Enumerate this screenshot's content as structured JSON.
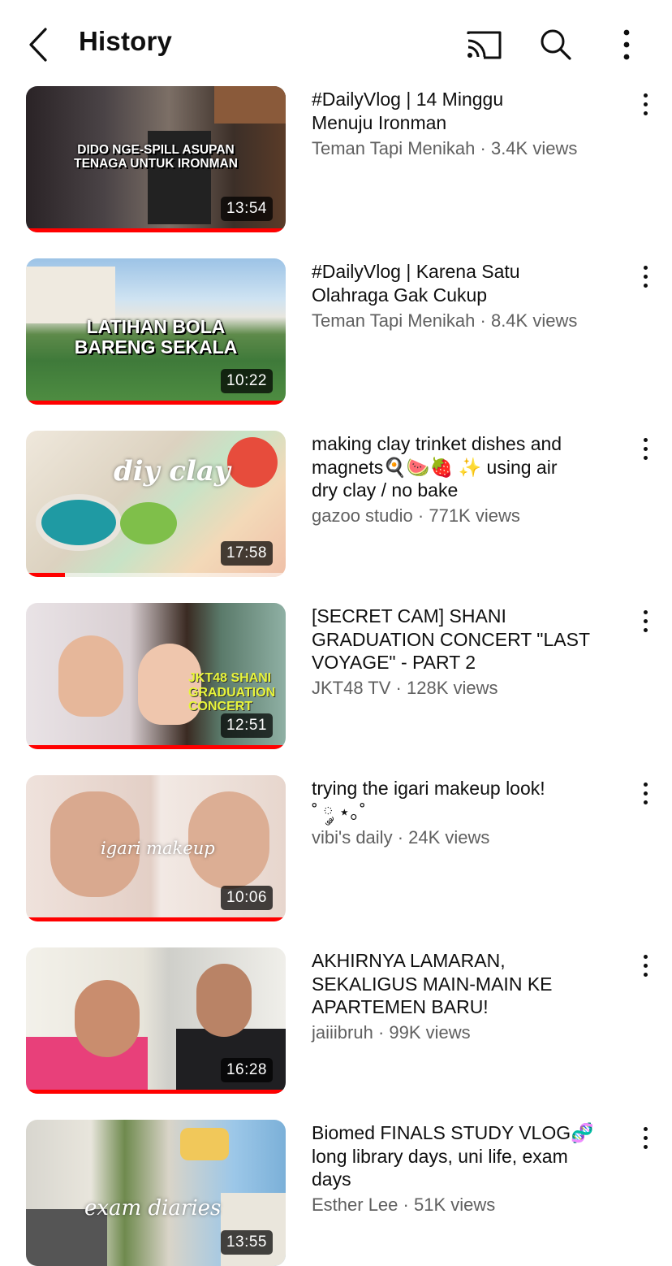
{
  "header": {
    "title": "History",
    "back_icon": "chevron-left-icon",
    "cast_icon": "cast-icon",
    "search_icon": "search-icon",
    "more_icon": "more-vertical-icon"
  },
  "colors": {
    "text_primary": "#0f0f0f",
    "text_secondary": "#606060",
    "progress": "#ff0000"
  },
  "videos": [
    {
      "title": "#DailyVlog | 14 Minggu\nMenuju Ironman",
      "channel": "Teman Tapi Menikah",
      "separator": "·",
      "views": "3.4K views",
      "duration": "13:54",
      "thumb_text": "DIDO NGE-SPILL ASUPAN\nTENAGA UNTUK IRONMAN",
      "progress": 1.0
    },
    {
      "title": "#DailyVlog | Karena Satu\nOlahraga Gak Cukup",
      "channel": "Teman Tapi Menikah",
      "separator": "·",
      "views": "8.4K views",
      "duration": "10:22",
      "thumb_text": "LATIHAN BOLA\nBARENG SEKALA",
      "progress": 1.0
    },
    {
      "title": "making clay trinket dishes and\nmagnets🍳🍉🍓 ✨ using air\ndry clay / no bake",
      "channel": "gazoo studio",
      "separator": "·",
      "views": "771K views",
      "duration": "17:58",
      "thumb_text": "diy clay",
      "progress": 0.15
    },
    {
      "title": "[SECRET CAM] SHANI\nGRADUATION CONCERT \"LAST\nVOYAGE\" - PART 2",
      "channel": "JKT48 TV",
      "separator": "·",
      "views": "128K views",
      "duration": "12:51",
      "thumb_text": "JKT48 SHANI\nGRADUATION\nCONCERT",
      "progress": 1.0
    },
    {
      "title": "trying the igari makeup look!\n˚ ༘ ⋆｡˚",
      "channel": "vibi's daily",
      "separator": "·",
      "views": "24K views",
      "duration": "10:06",
      "thumb_text": "igari makeup",
      "progress": 1.0
    },
    {
      "title": "AKHIRNYA LAMARAN,\nSEKALIGUS MAIN-MAIN KE\nAPARTEMEN BARU!",
      "channel": "jaiiibruh",
      "separator": "·",
      "views": "99K views",
      "duration": "16:28",
      "thumb_text": "",
      "progress": 1.0
    },
    {
      "title": "Biomed FINALS STUDY VLOG🧬\nlong library days, uni life, exam\ndays",
      "channel": "Esther Lee",
      "separator": "·",
      "views": "51K views",
      "duration": "13:55",
      "thumb_text": "exam diaries",
      "progress": 0.0
    }
  ]
}
